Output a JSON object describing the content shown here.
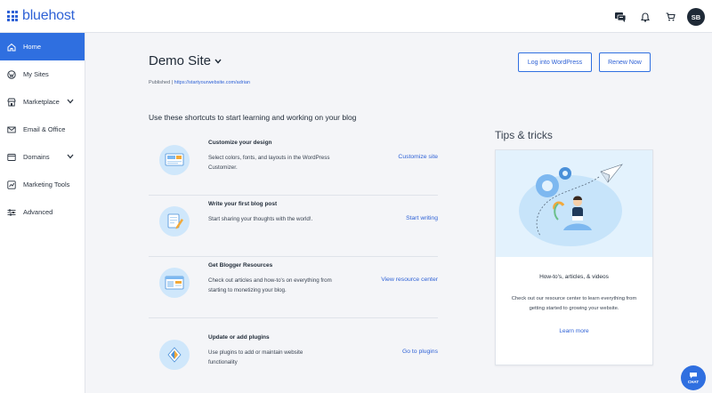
{
  "brand": {
    "name": "bluehost",
    "accent": "#2f6fe0"
  },
  "topbar": {
    "icons": [
      "chat-icon",
      "bell-icon",
      "cart-icon"
    ],
    "avatar_initials": "SB"
  },
  "sidebar": {
    "items": [
      {
        "label": "Home",
        "icon": "home-icon",
        "active": true
      },
      {
        "label": "My Sites",
        "icon": "wordpress-icon"
      },
      {
        "label": "Marketplace",
        "icon": "store-icon",
        "expandable": true
      },
      {
        "label": "Email & Office",
        "icon": "mail-icon"
      },
      {
        "label": "Domains",
        "icon": "globe-icon",
        "expandable": true
      },
      {
        "label": "Marketing Tools",
        "icon": "marketing-icon"
      },
      {
        "label": "Advanced",
        "icon": "sliders-icon"
      }
    ]
  },
  "site": {
    "title": "Demo Site",
    "published_label": "Published",
    "published_separator": " | ",
    "url": "https://startyourwebsite.com/adrian"
  },
  "actions": {
    "login": "Log into WordPress",
    "renew": "Renew Now"
  },
  "shortcuts": {
    "heading": "Use these shortcuts to start learning and working on your blog",
    "items": [
      {
        "title": "Customize your design",
        "desc": "Select colors, fonts, and layouts in the WordPress Customizer.",
        "link": "Customize site",
        "icon": "design-icon"
      },
      {
        "title": "Write your first blog post",
        "desc": "Start sharing your thoughts with the world!.",
        "link": "Start writing",
        "icon": "pencil-doc-icon"
      },
      {
        "title": "Get Blogger Resources",
        "desc": "Check out articles and how-to's on everything from starting to monetizing your blog.",
        "link": "View resource center",
        "icon": "resources-icon"
      },
      {
        "title": "Update or add plugins",
        "desc": "Use plugins to add or maintain website functionality",
        "link": "Go to plugins",
        "icon": "plugin-icon"
      }
    ]
  },
  "tips": {
    "heading": "Tips & tricks",
    "subtitle": "How-to's, articles, & videos",
    "desc": "Check out our resource center to learn everything from getting started to growing your website.",
    "link": "Learn more"
  },
  "chat": {
    "label": "CHAT"
  }
}
